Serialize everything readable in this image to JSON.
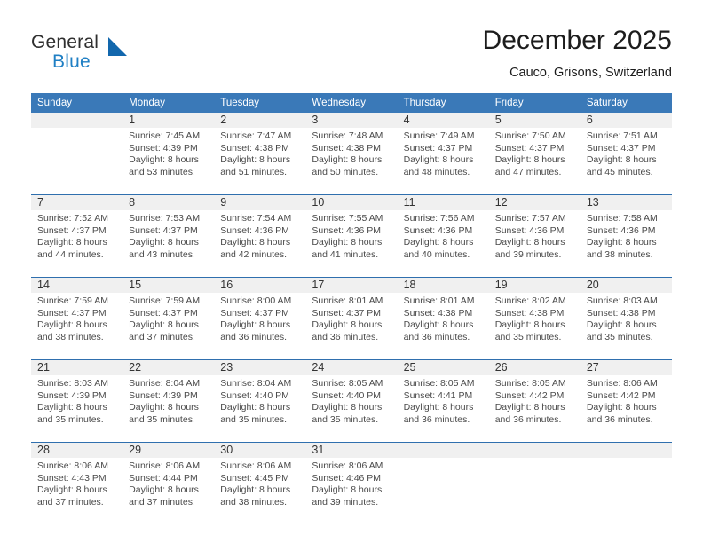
{
  "brand": {
    "name_part1": "General",
    "name_part2": "Blue",
    "triangle_color": "#1267ad",
    "blue_text_color": "#1f7fc4"
  },
  "header": {
    "month_title": "December 2025",
    "location": "Cauco, Grisons, Switzerland"
  },
  "theme": {
    "header_blue": "#3a79b8",
    "row_separator_blue": "#2f6fae",
    "daynum_band_gray": "#f0f0f0"
  },
  "calendar": {
    "weekday_headers": [
      "Sunday",
      "Monday",
      "Tuesday",
      "Wednesday",
      "Thursday",
      "Friday",
      "Saturday"
    ],
    "weeks": [
      [
        {
          "day": "",
          "empty": true,
          "sunrise": "",
          "sunset": "",
          "daylight_line1": "",
          "daylight_line2": ""
        },
        {
          "day": "1",
          "empty": false,
          "sunrise": "Sunrise: 7:45 AM",
          "sunset": "Sunset: 4:39 PM",
          "daylight_line1": "Daylight: 8 hours",
          "daylight_line2": "and 53 minutes."
        },
        {
          "day": "2",
          "empty": false,
          "sunrise": "Sunrise: 7:47 AM",
          "sunset": "Sunset: 4:38 PM",
          "daylight_line1": "Daylight: 8 hours",
          "daylight_line2": "and 51 minutes."
        },
        {
          "day": "3",
          "empty": false,
          "sunrise": "Sunrise: 7:48 AM",
          "sunset": "Sunset: 4:38 PM",
          "daylight_line1": "Daylight: 8 hours",
          "daylight_line2": "and 50 minutes."
        },
        {
          "day": "4",
          "empty": false,
          "sunrise": "Sunrise: 7:49 AM",
          "sunset": "Sunset: 4:37 PM",
          "daylight_line1": "Daylight: 8 hours",
          "daylight_line2": "and 48 minutes."
        },
        {
          "day": "5",
          "empty": false,
          "sunrise": "Sunrise: 7:50 AM",
          "sunset": "Sunset: 4:37 PM",
          "daylight_line1": "Daylight: 8 hours",
          "daylight_line2": "and 47 minutes."
        },
        {
          "day": "6",
          "empty": false,
          "sunrise": "Sunrise: 7:51 AM",
          "sunset": "Sunset: 4:37 PM",
          "daylight_line1": "Daylight: 8 hours",
          "daylight_line2": "and 45 minutes."
        }
      ],
      [
        {
          "day": "7",
          "empty": false,
          "sunrise": "Sunrise: 7:52 AM",
          "sunset": "Sunset: 4:37 PM",
          "daylight_line1": "Daylight: 8 hours",
          "daylight_line2": "and 44 minutes."
        },
        {
          "day": "8",
          "empty": false,
          "sunrise": "Sunrise: 7:53 AM",
          "sunset": "Sunset: 4:37 PM",
          "daylight_line1": "Daylight: 8 hours",
          "daylight_line2": "and 43 minutes."
        },
        {
          "day": "9",
          "empty": false,
          "sunrise": "Sunrise: 7:54 AM",
          "sunset": "Sunset: 4:36 PM",
          "daylight_line1": "Daylight: 8 hours",
          "daylight_line2": "and 42 minutes."
        },
        {
          "day": "10",
          "empty": false,
          "sunrise": "Sunrise: 7:55 AM",
          "sunset": "Sunset: 4:36 PM",
          "daylight_line1": "Daylight: 8 hours",
          "daylight_line2": "and 41 minutes."
        },
        {
          "day": "11",
          "empty": false,
          "sunrise": "Sunrise: 7:56 AM",
          "sunset": "Sunset: 4:36 PM",
          "daylight_line1": "Daylight: 8 hours",
          "daylight_line2": "and 40 minutes."
        },
        {
          "day": "12",
          "empty": false,
          "sunrise": "Sunrise: 7:57 AM",
          "sunset": "Sunset: 4:36 PM",
          "daylight_line1": "Daylight: 8 hours",
          "daylight_line2": "and 39 minutes."
        },
        {
          "day": "13",
          "empty": false,
          "sunrise": "Sunrise: 7:58 AM",
          "sunset": "Sunset: 4:36 PM",
          "daylight_line1": "Daylight: 8 hours",
          "daylight_line2": "and 38 minutes."
        }
      ],
      [
        {
          "day": "14",
          "empty": false,
          "sunrise": "Sunrise: 7:59 AM",
          "sunset": "Sunset: 4:37 PM",
          "daylight_line1": "Daylight: 8 hours",
          "daylight_line2": "and 38 minutes."
        },
        {
          "day": "15",
          "empty": false,
          "sunrise": "Sunrise: 7:59 AM",
          "sunset": "Sunset: 4:37 PM",
          "daylight_line1": "Daylight: 8 hours",
          "daylight_line2": "and 37 minutes."
        },
        {
          "day": "16",
          "empty": false,
          "sunrise": "Sunrise: 8:00 AM",
          "sunset": "Sunset: 4:37 PM",
          "daylight_line1": "Daylight: 8 hours",
          "daylight_line2": "and 36 minutes."
        },
        {
          "day": "17",
          "empty": false,
          "sunrise": "Sunrise: 8:01 AM",
          "sunset": "Sunset: 4:37 PM",
          "daylight_line1": "Daylight: 8 hours",
          "daylight_line2": "and 36 minutes."
        },
        {
          "day": "18",
          "empty": false,
          "sunrise": "Sunrise: 8:01 AM",
          "sunset": "Sunset: 4:38 PM",
          "daylight_line1": "Daylight: 8 hours",
          "daylight_line2": "and 36 minutes."
        },
        {
          "day": "19",
          "empty": false,
          "sunrise": "Sunrise: 8:02 AM",
          "sunset": "Sunset: 4:38 PM",
          "daylight_line1": "Daylight: 8 hours",
          "daylight_line2": "and 35 minutes."
        },
        {
          "day": "20",
          "empty": false,
          "sunrise": "Sunrise: 8:03 AM",
          "sunset": "Sunset: 4:38 PM",
          "daylight_line1": "Daylight: 8 hours",
          "daylight_line2": "and 35 minutes."
        }
      ],
      [
        {
          "day": "21",
          "empty": false,
          "sunrise": "Sunrise: 8:03 AM",
          "sunset": "Sunset: 4:39 PM",
          "daylight_line1": "Daylight: 8 hours",
          "daylight_line2": "and 35 minutes."
        },
        {
          "day": "22",
          "empty": false,
          "sunrise": "Sunrise: 8:04 AM",
          "sunset": "Sunset: 4:39 PM",
          "daylight_line1": "Daylight: 8 hours",
          "daylight_line2": "and 35 minutes."
        },
        {
          "day": "23",
          "empty": false,
          "sunrise": "Sunrise: 8:04 AM",
          "sunset": "Sunset: 4:40 PM",
          "daylight_line1": "Daylight: 8 hours",
          "daylight_line2": "and 35 minutes."
        },
        {
          "day": "24",
          "empty": false,
          "sunrise": "Sunrise: 8:05 AM",
          "sunset": "Sunset: 4:40 PM",
          "daylight_line1": "Daylight: 8 hours",
          "daylight_line2": "and 35 minutes."
        },
        {
          "day": "25",
          "empty": false,
          "sunrise": "Sunrise: 8:05 AM",
          "sunset": "Sunset: 4:41 PM",
          "daylight_line1": "Daylight: 8 hours",
          "daylight_line2": "and 36 minutes."
        },
        {
          "day": "26",
          "empty": false,
          "sunrise": "Sunrise: 8:05 AM",
          "sunset": "Sunset: 4:42 PM",
          "daylight_line1": "Daylight: 8 hours",
          "daylight_line2": "and 36 minutes."
        },
        {
          "day": "27",
          "empty": false,
          "sunrise": "Sunrise: 8:06 AM",
          "sunset": "Sunset: 4:42 PM",
          "daylight_line1": "Daylight: 8 hours",
          "daylight_line2": "and 36 minutes."
        }
      ],
      [
        {
          "day": "28",
          "empty": false,
          "sunrise": "Sunrise: 8:06 AM",
          "sunset": "Sunset: 4:43 PM",
          "daylight_line1": "Daylight: 8 hours",
          "daylight_line2": "and 37 minutes."
        },
        {
          "day": "29",
          "empty": false,
          "sunrise": "Sunrise: 8:06 AM",
          "sunset": "Sunset: 4:44 PM",
          "daylight_line1": "Daylight: 8 hours",
          "daylight_line2": "and 37 minutes."
        },
        {
          "day": "30",
          "empty": false,
          "sunrise": "Sunrise: 8:06 AM",
          "sunset": "Sunset: 4:45 PM",
          "daylight_line1": "Daylight: 8 hours",
          "daylight_line2": "and 38 minutes."
        },
        {
          "day": "31",
          "empty": false,
          "sunrise": "Sunrise: 8:06 AM",
          "sunset": "Sunset: 4:46 PM",
          "daylight_line1": "Daylight: 8 hours",
          "daylight_line2": "and 39 minutes."
        },
        {
          "day": "",
          "empty": true,
          "sunrise": "",
          "sunset": "",
          "daylight_line1": "",
          "daylight_line2": ""
        },
        {
          "day": "",
          "empty": true,
          "sunrise": "",
          "sunset": "",
          "daylight_line1": "",
          "daylight_line2": ""
        },
        {
          "day": "",
          "empty": true,
          "sunrise": "",
          "sunset": "",
          "daylight_line1": "",
          "daylight_line2": ""
        }
      ]
    ]
  }
}
